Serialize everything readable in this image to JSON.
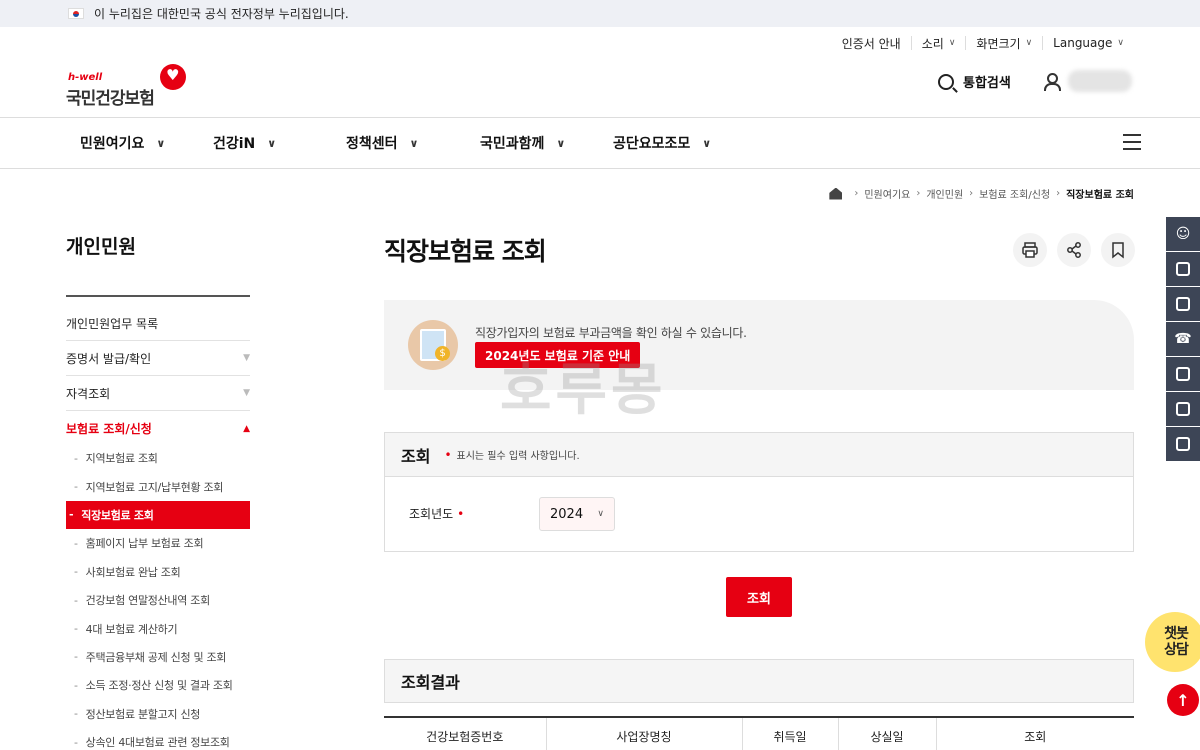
{
  "gov_bar": {
    "text": "이 누리집은 대한민국 공식 전자정부 누리집입니다."
  },
  "util_links": [
    {
      "label": "인증서 안내",
      "has_chevron": false
    },
    {
      "label": "소리",
      "has_chevron": true
    },
    {
      "label": "화면크기",
      "has_chevron": true
    },
    {
      "label": "Language",
      "has_chevron": true
    }
  ],
  "logo": {
    "brand": "h-well",
    "name": "국민건강보험"
  },
  "header": {
    "search_label": "통합검색"
  },
  "gnb": [
    {
      "label": "민원여기요"
    },
    {
      "label": "건강iN"
    },
    {
      "label": "정책센터"
    },
    {
      "label": "국민과함께"
    },
    {
      "label": "공단요모조모"
    }
  ],
  "breadcrumb": [
    "민원여기요",
    "개인민원",
    "보험료 조회/신청",
    "직장보험료 조회"
  ],
  "sidebar": {
    "title": "개인민원",
    "items": [
      {
        "label": "개인민원업무 목록",
        "has_toggle": false
      },
      {
        "label": "증명서 발급/확인",
        "has_toggle": true
      },
      {
        "label": "자격조회",
        "has_toggle": true
      },
      {
        "label": "보험료 조회/신청",
        "has_toggle": true,
        "active": true
      }
    ],
    "sub_items": [
      "지역보험료 조회",
      "지역보험료 고지/납부현황 조회",
      "직장보험료 조회",
      "홈페이지 납부 보험료 조회",
      "사회보험료 완납 조회",
      "건강보험 연말정산내역 조회",
      "4대 보험료 계산하기",
      "주택금융부채 공제 신청 및 조회",
      "소득 조정·정산 신청 및 결과 조회",
      "정산보험료 분할고지 신청",
      "상속인 4대보험료 관련 정보조회"
    ],
    "active_sub": "직장보험료 조회"
  },
  "main": {
    "title": "직장보험료 조회",
    "info_text": "직장가입자의 보험료 부과금액을 확인 하실 수 있습니다.",
    "notice_button": "2024년도 보험료 기준 안내",
    "watermark": "호루몽",
    "query": {
      "title": "조회",
      "required_note": "표시는 필수 입력 사항입니다.",
      "year_label": "조회년도",
      "year_value": "2024"
    },
    "search_button": "조회",
    "result": {
      "title": "조회결과",
      "columns": [
        "건강보험증번호",
        "사업장명칭",
        "취득일",
        "상실일",
        "조회"
      ]
    }
  },
  "floating": {
    "chatbot_line1": "챗봇",
    "chatbot_line2": "상담",
    "top_symbol": "↑"
  },
  "colors": {
    "accent": "#e60012",
    "quick_bar": "#3d4556",
    "chatbot": "#ffe36e"
  }
}
